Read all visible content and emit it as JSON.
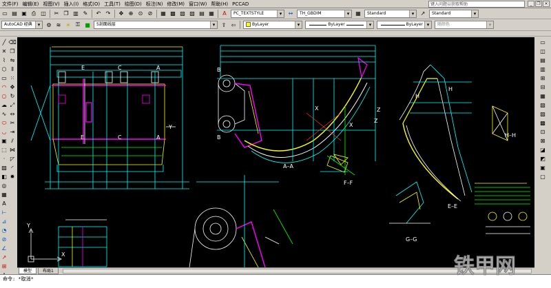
{
  "menu": [
    "文件(F)",
    "编辑(E)",
    "视图(V)",
    "插入(I)",
    "格式(O)",
    "工具(T)",
    "绘图(D)",
    "标注(N)",
    "修改(M)",
    "窗口(W)",
    "帮助(H)",
    "PCCAD"
  ],
  "help_placeholder": "键入问题以获取帮助",
  "toolbar1": {
    "textstyle": "PC_TEXTSTYLE",
    "dimstyle": "TH_GBDIM",
    "tablestyle": "Standard",
    "multileader": "Standard"
  },
  "toolbar2": {
    "workspace": "AutoCAD 经典",
    "layer": "5剖面线层",
    "color": "ByLayer",
    "linetype": "ByLayer",
    "lineweight": "ByLayer",
    "plotstyle": "随颜色"
  },
  "tabs": [
    "模型",
    "布局1"
  ],
  "command_line": "命令: *取消*",
  "colors": {
    "background": "#000000",
    "cyan": "#00ffff",
    "yellow": "#ffff00",
    "magenta": "#ff00ff",
    "white": "#ffffff",
    "green": "#00ff00",
    "red": "#ff3030",
    "blue": "#4060ff"
  },
  "drawing_labels": {
    "left_view": [
      "E",
      "C",
      "A",
      "E",
      "C",
      "A",
      "Y"
    ],
    "center": [
      "B",
      "B",
      "X",
      "X",
      "Z",
      "Z",
      "A–A"
    ],
    "sections": [
      "H",
      "H",
      "H–H",
      "F–F",
      "G–G",
      "E–E"
    ],
    "ucs": [
      "Y",
      "X"
    ]
  },
  "watermark": "铁甲网"
}
